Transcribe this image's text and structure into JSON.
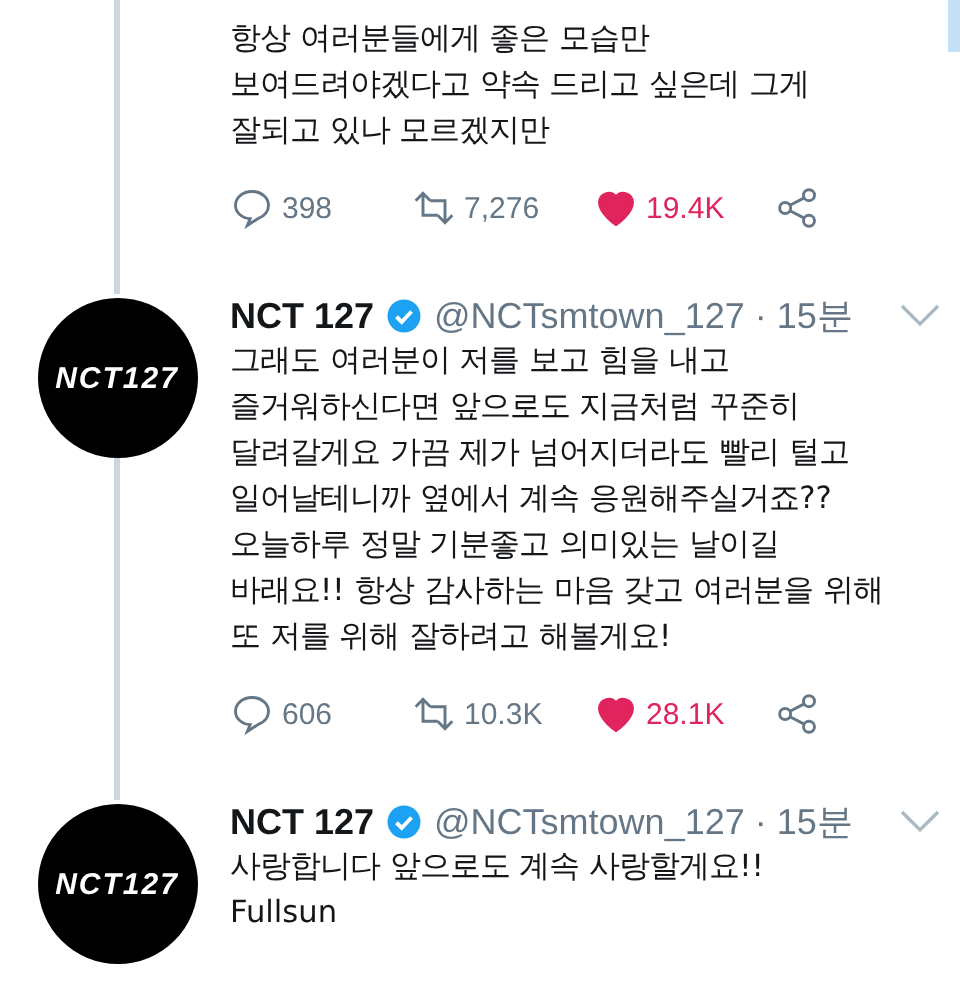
{
  "tweets": [
    {
      "text": "항상 여러분들에게 좋은 모습만\n보여드려야겠다고 약속 드리고 싶은데 그게\n잘되고 있나 모르겠지만",
      "replies": "398",
      "retweets": "7,276",
      "likes": "19.4K",
      "liked": true
    },
    {
      "author": {
        "name": "NCT 127",
        "verified": true,
        "handle": "@NCTsmtown_127",
        "time": "· 15분",
        "logo": "NCT127"
      },
      "text": "그래도 여러분이 저를 보고 힘을 내고\n즐거워하신다면 앞으로도 지금처럼 꾸준히\n달려갈게요 가끔 제가 넘어지더라도 빨리 털고\n일어날테니까 옆에서 계속 응원해주실거죠??\n오늘하루 정말 기분좋고 의미있는 날이길\n바래요!! 항상 감사하는 마음 갖고 여러분을 위해\n또 저를 위해 잘하려고 해볼게요!",
      "replies": "606",
      "retweets": "10.3K",
      "likes": "28.1K",
      "liked": true
    },
    {
      "author": {
        "name": "NCT 127",
        "verified": true,
        "handle": "@NCTsmtown_127",
        "time": "· 15분",
        "logo": "NCT127"
      },
      "text": "사랑합니다 앞으로도 계속 사랑할게요!!\nFullsun"
    }
  ]
}
